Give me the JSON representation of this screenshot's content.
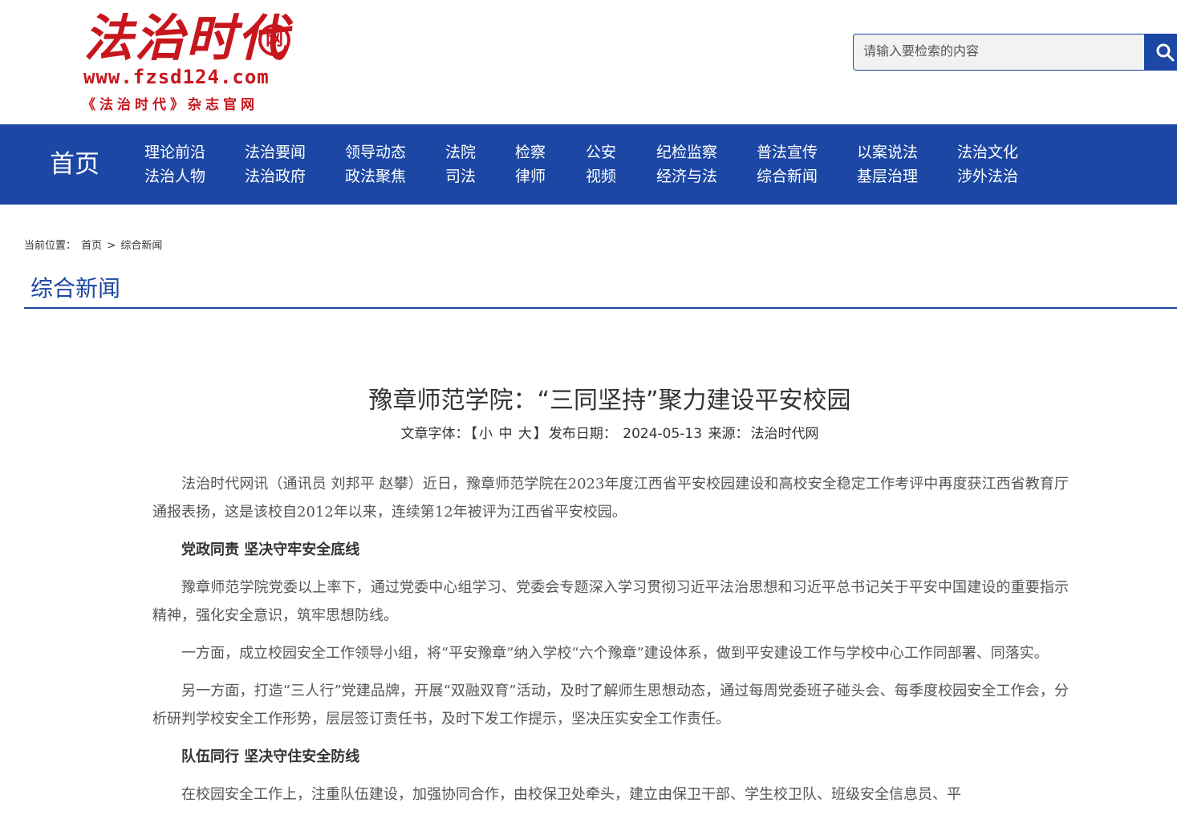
{
  "header": {
    "logo_title": "法治时代",
    "logo_badge": "网",
    "logo_url": "www.fzsd124.com",
    "logo_sub": "《法治时代》杂志官网",
    "search_placeholder": "请输入要检索的内容"
  },
  "nav": {
    "home": "首页",
    "columns": [
      [
        "理论前沿",
        "法治人物"
      ],
      [
        "法治要闻",
        "法治政府"
      ],
      [
        "领导动态",
        "政法聚焦"
      ],
      [
        "法院",
        "司法"
      ],
      [
        "检察",
        "律师"
      ],
      [
        "公安",
        "视频"
      ],
      [
        "纪检监察",
        "经济与法"
      ],
      [
        "普法宣传",
        "综合新闻"
      ],
      [
        "以案说法",
        "基层治理"
      ],
      [
        "法治文化",
        "涉外法治"
      ]
    ]
  },
  "breadcrumb": {
    "label": "当前位置：",
    "home": "首页",
    "sep": ">",
    "current": "综合新闻"
  },
  "section_title": "综合新闻",
  "article": {
    "title": "豫章师范学院：“三同坚持”聚力建设平安校园",
    "meta_font_label": "文章字体：",
    "meta_font_open": "【",
    "meta_font_small": "小",
    "meta_font_medium": "中",
    "meta_font_large": "大",
    "meta_font_close": "】",
    "meta_date_label": "发布日期：",
    "meta_date": "2024-05-13",
    "meta_source_label": "来源：",
    "meta_source": "法治时代网",
    "paragraphs": [
      {
        "type": "text",
        "text": "法治时代网讯（通讯员 刘邦平 赵攀）近日，豫章师范学院在2023年度江西省平安校园建设和高校安全稳定工作考评中再度获江西省教育厅通报表扬，这是该校自2012年以来，连续第12年被评为江西省平安校园。"
      },
      {
        "type": "sub",
        "text": "党政同责 坚决守牢安全底线"
      },
      {
        "type": "text",
        "text": "豫章师范学院党委以上率下，通过党委中心组学习、党委会专题深入学习贯彻习近平法治思想和习近平总书记关于平安中国建设的重要指示精神，强化安全意识，筑牢思想防线。"
      },
      {
        "type": "text",
        "text": "一方面，成立校园安全工作领导小组，将“平安豫章”纳入学校“六个豫章”建设体系，做到平安建设工作与学校中心工作同部署、同落实。"
      },
      {
        "type": "text",
        "text": "另一方面，打造“三人行”党建品牌，开展“双融双育”活动，及时了解师生思想动态，通过每周党委班子碰头会、每季度校园安全工作会，分析研判学校安全工作形势，层层签订责任书，及时下发工作提示，坚决压实安全工作责任。"
      },
      {
        "type": "sub",
        "text": "队伍同行 坚决守住安全防线"
      },
      {
        "type": "text",
        "text": "在校园安全工作上，注重队伍建设，加强协同合作，由校保卫处牵头，建立由保卫干部、学生校卫队、班级安全信息员、平"
      }
    ]
  }
}
